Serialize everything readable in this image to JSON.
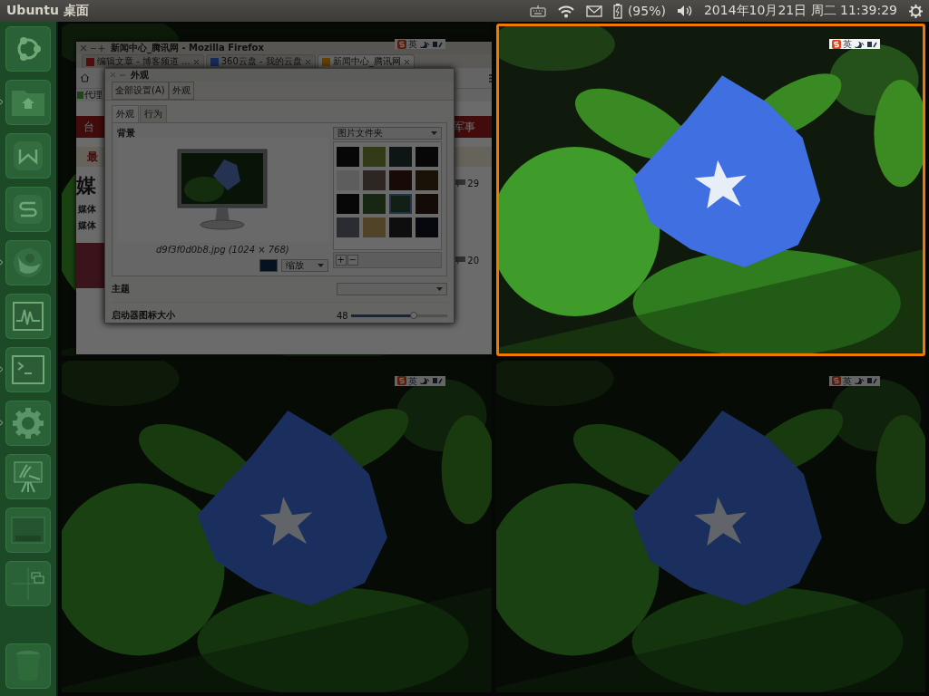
{
  "top_panel": {
    "title": "Ubuntu 桌面",
    "battery": "(95%)",
    "clock": "2014年10月21日 周二 11:39:29"
  },
  "launcher": [
    {
      "kind": "ubuntu",
      "running": false
    },
    {
      "kind": "files",
      "running": true
    },
    {
      "kind": "writer",
      "running": false
    },
    {
      "kind": "wps",
      "running": false
    },
    {
      "kind": "firefox",
      "running": true
    },
    {
      "kind": "monitor",
      "running": false
    },
    {
      "kind": "terminal",
      "running": true
    },
    {
      "kind": "settings",
      "running": true
    },
    {
      "kind": "presenter",
      "running": false
    },
    {
      "kind": "desktop",
      "running": false
    },
    {
      "kind": "workspaces",
      "running": false
    },
    {
      "kind": "trash",
      "running": false
    }
  ],
  "workspaces": [
    {
      "selected": false,
      "ime": "英",
      "has_windows": true
    },
    {
      "selected": true,
      "ime": "英",
      "has_windows": false
    },
    {
      "selected": false,
      "ime": "英",
      "has_windows": false
    },
    {
      "selected": false,
      "ime": "英",
      "has_windows": false
    }
  ],
  "firefox": {
    "title": "新闻中心_腾讯网 - Mozilla Firefox",
    "tabs": [
      {
        "label": "编辑文章 - 博客频道 ...",
        "selected": false
      },
      {
        "label": "360云盘 - 我的云盘",
        "selected": false
      },
      {
        "label": "新闻中心_腾讯网",
        "selected": true
      }
    ],
    "bookmark": "代理",
    "nav_left": "台",
    "nav_right": "军事",
    "latest": "最",
    "headline": "媒",
    "bullets": [
      "媒体",
      "媒体"
    ],
    "comment_counts": [
      "29",
      "20"
    ]
  },
  "appearance_dialog": {
    "title": "外观",
    "toolbar": [
      "全部设置(A)",
      "外观"
    ],
    "tabs": [
      {
        "label": "外观",
        "selected": true
      },
      {
        "label": "行为",
        "selected": false
      }
    ],
    "background_label": "背景",
    "folder": "图片文件夹",
    "caption": "d9f3f0d0b8.jpg (1024 × 768)",
    "scaling": "缩放",
    "thumbnails": [
      {
        "selected": false
      },
      {
        "selected": false
      },
      {
        "selected": false
      },
      {
        "selected": false
      },
      {
        "selected": false
      },
      {
        "selected": false
      },
      {
        "selected": false
      },
      {
        "selected": false
      },
      {
        "selected": false
      },
      {
        "selected": false
      },
      {
        "selected": true
      },
      {
        "selected": false
      },
      {
        "selected": false
      },
      {
        "selected": false
      },
      {
        "selected": false
      },
      {
        "selected": false
      }
    ],
    "add": "+",
    "remove": "−",
    "theme_label": "主题",
    "icon_size_label": "启动器图标大小",
    "icon_size": "48",
    "icon_size_slider": {
      "level": 0.65
    }
  }
}
